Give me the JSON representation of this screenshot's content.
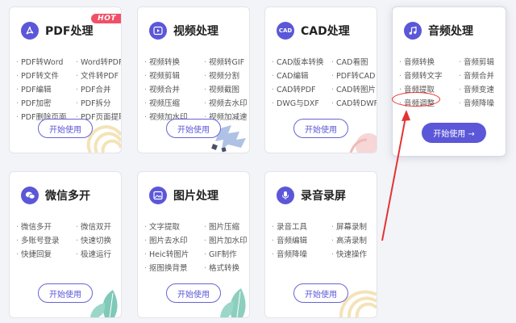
{
  "cards": [
    {
      "title": "PDF处理",
      "badge": "HOT",
      "icon": "pdf-icon",
      "items": [
        "PDF转Word",
        "Word转PDF",
        "PDF转文件",
        "文件转PDF",
        "PDF编辑",
        "PDF合并",
        "PDF加密",
        "PDF拆分",
        "PDF删除页面",
        "PDF页面提取"
      ],
      "button": "开始使用"
    },
    {
      "title": "视频处理",
      "icon": "video-play-icon",
      "items": [
        "视频转换",
        "视频转GIF",
        "视频剪辑",
        "视频分割",
        "视频合并",
        "视频截图",
        "视频压缩",
        "视频去水印",
        "视频加水印",
        "视频加减速"
      ],
      "button": "开始使用"
    },
    {
      "title": "CAD处理",
      "icon": "cad-icon",
      "items": [
        "CAD版本转换",
        "CAD看图",
        "CAD编辑",
        "PDF转CAD",
        "CAD转PDF",
        "CAD转图片",
        "DWG与DXF",
        "CAD转DWF"
      ],
      "button": "开始使用"
    },
    {
      "title": "音频处理",
      "icon": "music-note-icon",
      "items": [
        "音频转换",
        "音频剪辑",
        "音频转文字",
        "音频合并",
        "音频提取",
        "音频变速",
        "音频调整",
        "音频降噪"
      ],
      "button": "开始使用 →"
    },
    {
      "title": "微信多开",
      "icon": "wechat-icon",
      "items": [
        "微信多开",
        "微信双开",
        "多账号登录",
        "快速切换",
        "快捷回复",
        "极速运行"
      ],
      "button": "开始使用"
    },
    {
      "title": "图片处理",
      "icon": "image-icon",
      "items": [
        "文字提取",
        "图片压缩",
        "图片去水印",
        "图片加水印",
        "Heic转图片",
        "GIF制作",
        "抠图换背景",
        "格式转换"
      ],
      "button": "开始使用"
    },
    {
      "title": "录音录屏",
      "icon": "microphone-icon",
      "items": [
        "录音工具",
        "屏幕录制",
        "音频编辑",
        "高清录制",
        "音频降噪",
        "快速操作"
      ],
      "button": "开始使用"
    }
  ],
  "annotation_color": "#e33333",
  "accent_color": "#5b57d8"
}
